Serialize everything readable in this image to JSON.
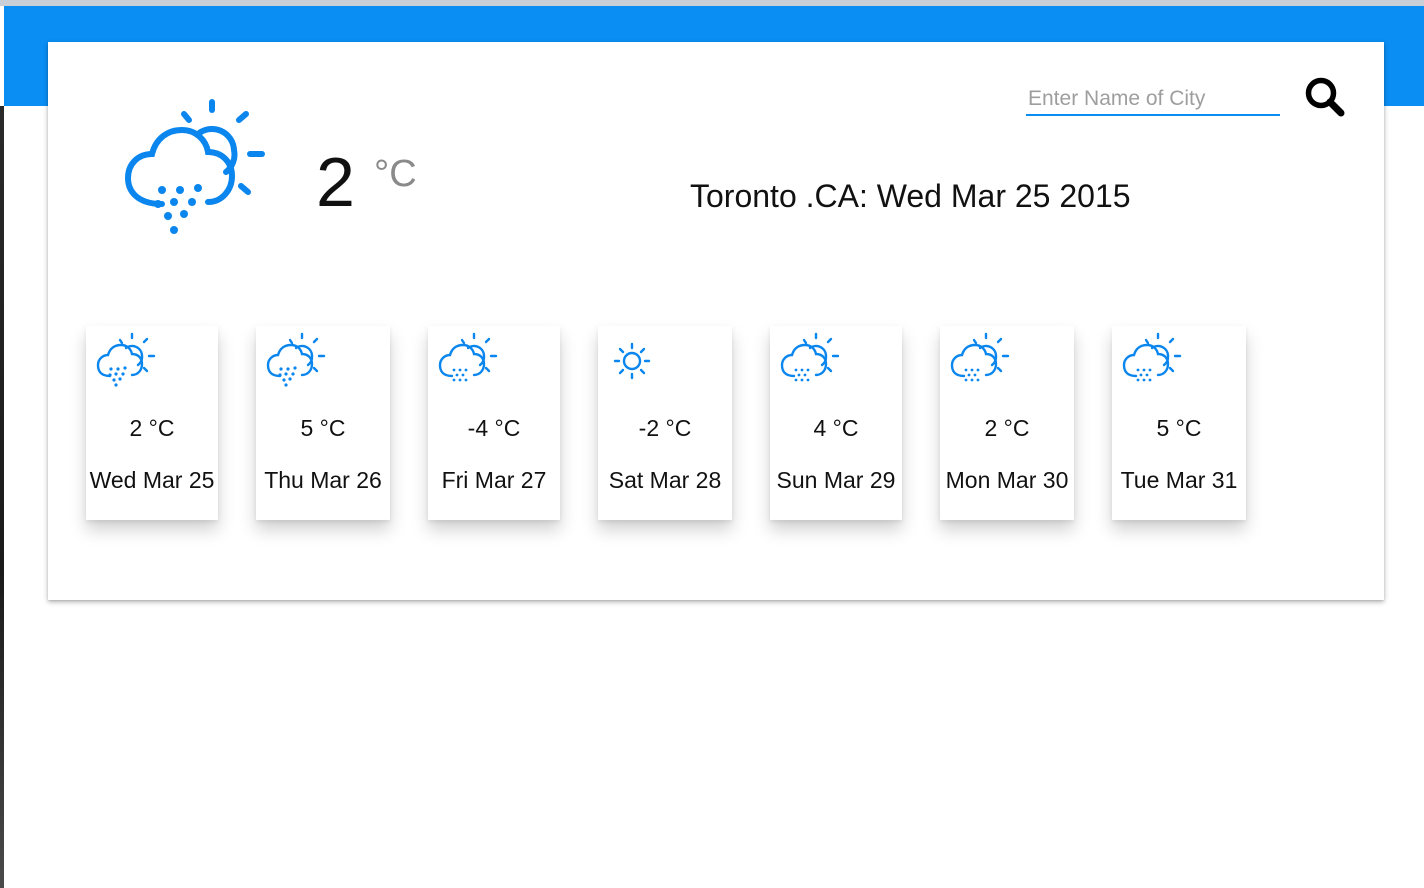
{
  "theme": {
    "accent": "#0a8ef4",
    "icon_color": "#0a86ee"
  },
  "search": {
    "placeholder": "Enter Name of City",
    "value": "",
    "button_icon": "search-icon"
  },
  "current": {
    "icon": "rain-partly-cloudy-icon",
    "temperature": "2",
    "unit": "°C",
    "location": "Toronto .CA: Wed Mar 25 2015"
  },
  "forecast": [
    {
      "temp": "2 °C",
      "date": "Wed Mar 25",
      "icon": "rain-partly-cloudy-icon"
    },
    {
      "temp": "5 °C",
      "date": "Thu Mar 26",
      "icon": "rain-partly-cloudy-icon"
    },
    {
      "temp": "-4 °C",
      "date": "Fri Mar 27",
      "icon": "snow-partly-cloudy-icon"
    },
    {
      "temp": "-2 °C",
      "date": "Sat Mar 28",
      "icon": "sun-icon"
    },
    {
      "temp": "4 °C",
      "date": "Sun Mar 29",
      "icon": "snow-partly-cloudy-icon"
    },
    {
      "temp": "2 °C",
      "date": "Mon Mar 30",
      "icon": "snow-partly-cloudy-icon"
    },
    {
      "temp": "5 °C",
      "date": "Tue Mar 31",
      "icon": "snow-partly-cloudy-icon"
    }
  ]
}
